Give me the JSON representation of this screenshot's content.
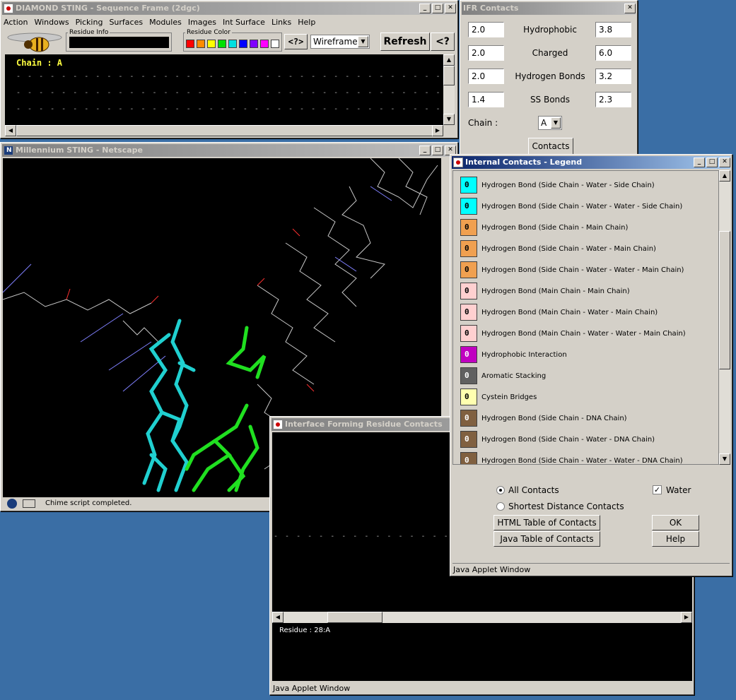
{
  "seq_window": {
    "title": "DIAMOND STING - Sequence Frame (2dgc)",
    "menu": [
      "Action",
      "Windows",
      "Picking",
      "Surfaces",
      "Modules",
      "Images",
      "Int Surface",
      "Links",
      "Help"
    ],
    "residue_info_label": "Residue Info",
    "residue_info_value": "",
    "residue_color_label": "Residue Color",
    "colors": [
      "#ff0000",
      "#ff8c00",
      "#ffff00",
      "#00e000",
      "#00e0e0",
      "#0000ff",
      "#8000ff",
      "#ff00ff",
      "#ffffff"
    ],
    "query_btn": "<?>",
    "render_mode": "Wireframe",
    "refresh_btn": "Refresh",
    "help_btn": "<?",
    "chain_text": "Chain : A",
    "dash_line": "- - - - - - - - - - - - - - - - - - - - - - - - - - - - - - - - - - - - - - - - - - - - - - - - - -"
  },
  "netscape_window": {
    "title": "Millennium STING - Netscape",
    "status": "Chime script completed."
  },
  "ifr_window": {
    "title": "IFR Contacts",
    "rows": [
      {
        "left": "2.0",
        "label": "Hydrophobic",
        "right": "3.8"
      },
      {
        "left": "2.0",
        "label": "Charged",
        "right": "6.0"
      },
      {
        "left": "2.0",
        "label": "Hydrogen Bonds",
        "right": "3.2"
      },
      {
        "left": "1.4",
        "label": "SS Bonds",
        "right": "2.3"
      }
    ],
    "chain_label": "Chain :",
    "chain_value": "A",
    "contacts_btn": "Contacts"
  },
  "legend_window": {
    "title": "Internal Contacts - Legend",
    "items": [
      {
        "count": "0",
        "color": "#00ffff",
        "label": "Hydrogen Bond (Side Chain - Water - Side Chain)"
      },
      {
        "count": "0",
        "color": "#00ffff",
        "label": "Hydrogen Bond (Side Chain - Water - Water - Side Chain)"
      },
      {
        "count": "0",
        "color": "#f0a050",
        "label": "Hydrogen Bond (Side Chain - Main Chain)"
      },
      {
        "count": "0",
        "color": "#f0a050",
        "label": "Hydrogen Bond (Side Chain - Water - Main Chain)"
      },
      {
        "count": "0",
        "color": "#f0a050",
        "label": "Hydrogen Bond (Side Chain - Water - Water - Main Chain)"
      },
      {
        "count": "0",
        "color": "#ffd0d0",
        "label": "Hydrogen Bond (Main Chain - Main Chain)"
      },
      {
        "count": "0",
        "color": "#ffd0d0",
        "label": "Hydrogen Bond (Main Chain - Water - Main Chain)"
      },
      {
        "count": "0",
        "color": "#ffd0d0",
        "label": "Hydrogen Bond (Main Chain - Water - Water - Main Chain)"
      },
      {
        "count": "0",
        "color": "#c000c0",
        "label": "Hydrophobic Interaction"
      },
      {
        "count": "0",
        "color": "#606060",
        "label": "Aromatic Stacking"
      },
      {
        "count": "0",
        "color": "#ffffb0",
        "label": "Cystein Bridges"
      },
      {
        "count": "0",
        "color": "#806040",
        "label": "Hydrogen Bond (Side Chain - DNA Chain)"
      },
      {
        "count": "0",
        "color": "#806040",
        "label": "Hydrogen Bond (Side Chain - Water - DNA Chain)"
      },
      {
        "count": "0",
        "color": "#806040",
        "label": "Hydrogen Bond (Side Chain - Water - Water - DNA Chain)"
      }
    ],
    "all_contacts": "All Contacts",
    "shortest": "Shortest Distance Contacts",
    "water": "Water",
    "html_table": "HTML Table of Contacts",
    "java_table": "Java Table of Contacts",
    "ok": "OK",
    "help": "Help",
    "status": "Java Applet Window"
  },
  "ifrc_window": {
    "title": "Interface Forming Residue Contacts",
    "dash_line": "- - - - - - - - - - - - - - - - - - - - - - - - - - - - - - - - - - - - - - - - - - - - - - - -",
    "residue_text": "Residue : 28:A",
    "status": "Java Applet Window"
  }
}
